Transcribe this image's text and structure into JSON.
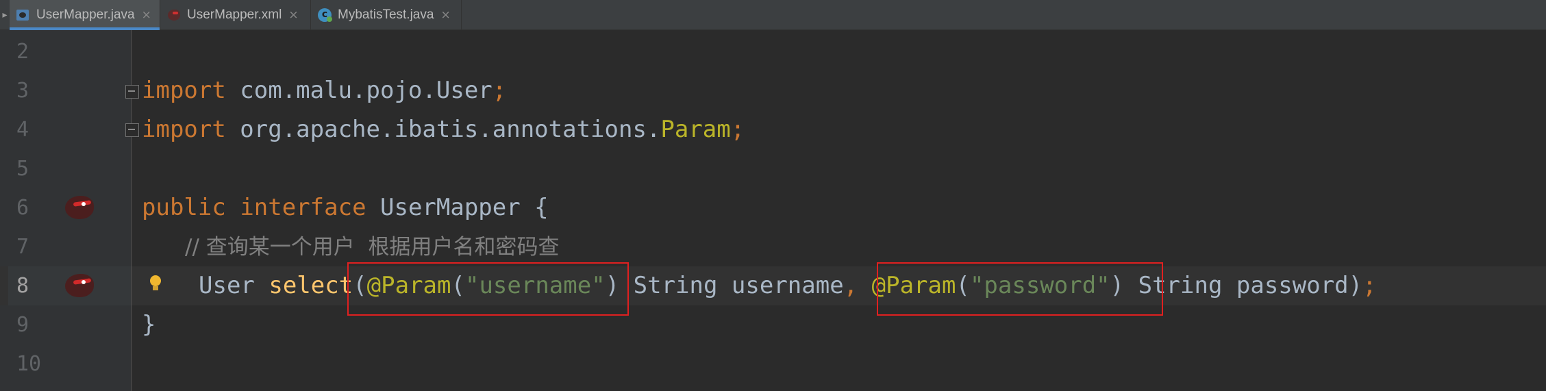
{
  "tabs": [
    {
      "label": "UserMapper.java",
      "icon": "java-interface-icon",
      "active": true
    },
    {
      "label": "UserMapper.xml",
      "icon": "mybatis-xml-icon",
      "active": false
    },
    {
      "label": "MybatisTest.java",
      "icon": "java-class-icon",
      "active": false
    }
  ],
  "tab_close_glyph": "×",
  "editor": {
    "lines": [
      {
        "number": "2"
      },
      {
        "number": "3",
        "keyword": "import",
        "path": " com.malu.pojo.User",
        "semicolon": ";"
      },
      {
        "number": "4",
        "keyword": "import",
        "path": " org.apache.ibatis.annotations.",
        "type": "Param",
        "semicolon": ";"
      },
      {
        "number": "5"
      },
      {
        "number": "6",
        "kw1": "public",
        "kw2": "interface",
        "name": " UserMapper {"
      },
      {
        "number": "7",
        "comment": "// 查询某一个用户  根据用户名和密码查"
      },
      {
        "number": "8",
        "ret": "User ",
        "method": "select",
        "open": "(",
        "ann1": "@Param",
        "arg1_open": "(",
        "str1": "\"username\"",
        "arg1_close": ")",
        "p1": " String username",
        "comma": ", ",
        "ann2": "@Param",
        "arg2_open": "(",
        "str2": "\"password\"",
        "arg2_close": ")",
        "p2": " String password)",
        "semicolon": ";"
      },
      {
        "number": "9",
        "brace": "}"
      },
      {
        "number": "10"
      }
    ]
  },
  "colors": {
    "background": "#2b2b2b",
    "keyword": "#cc7832",
    "annotation": "#bbb529",
    "string": "#6a8759",
    "comment": "#808080",
    "method": "#ffc66d",
    "text": "#a9b7c6",
    "highlight_box": "#e02020",
    "active_tab_underline": "#4a88c7"
  }
}
